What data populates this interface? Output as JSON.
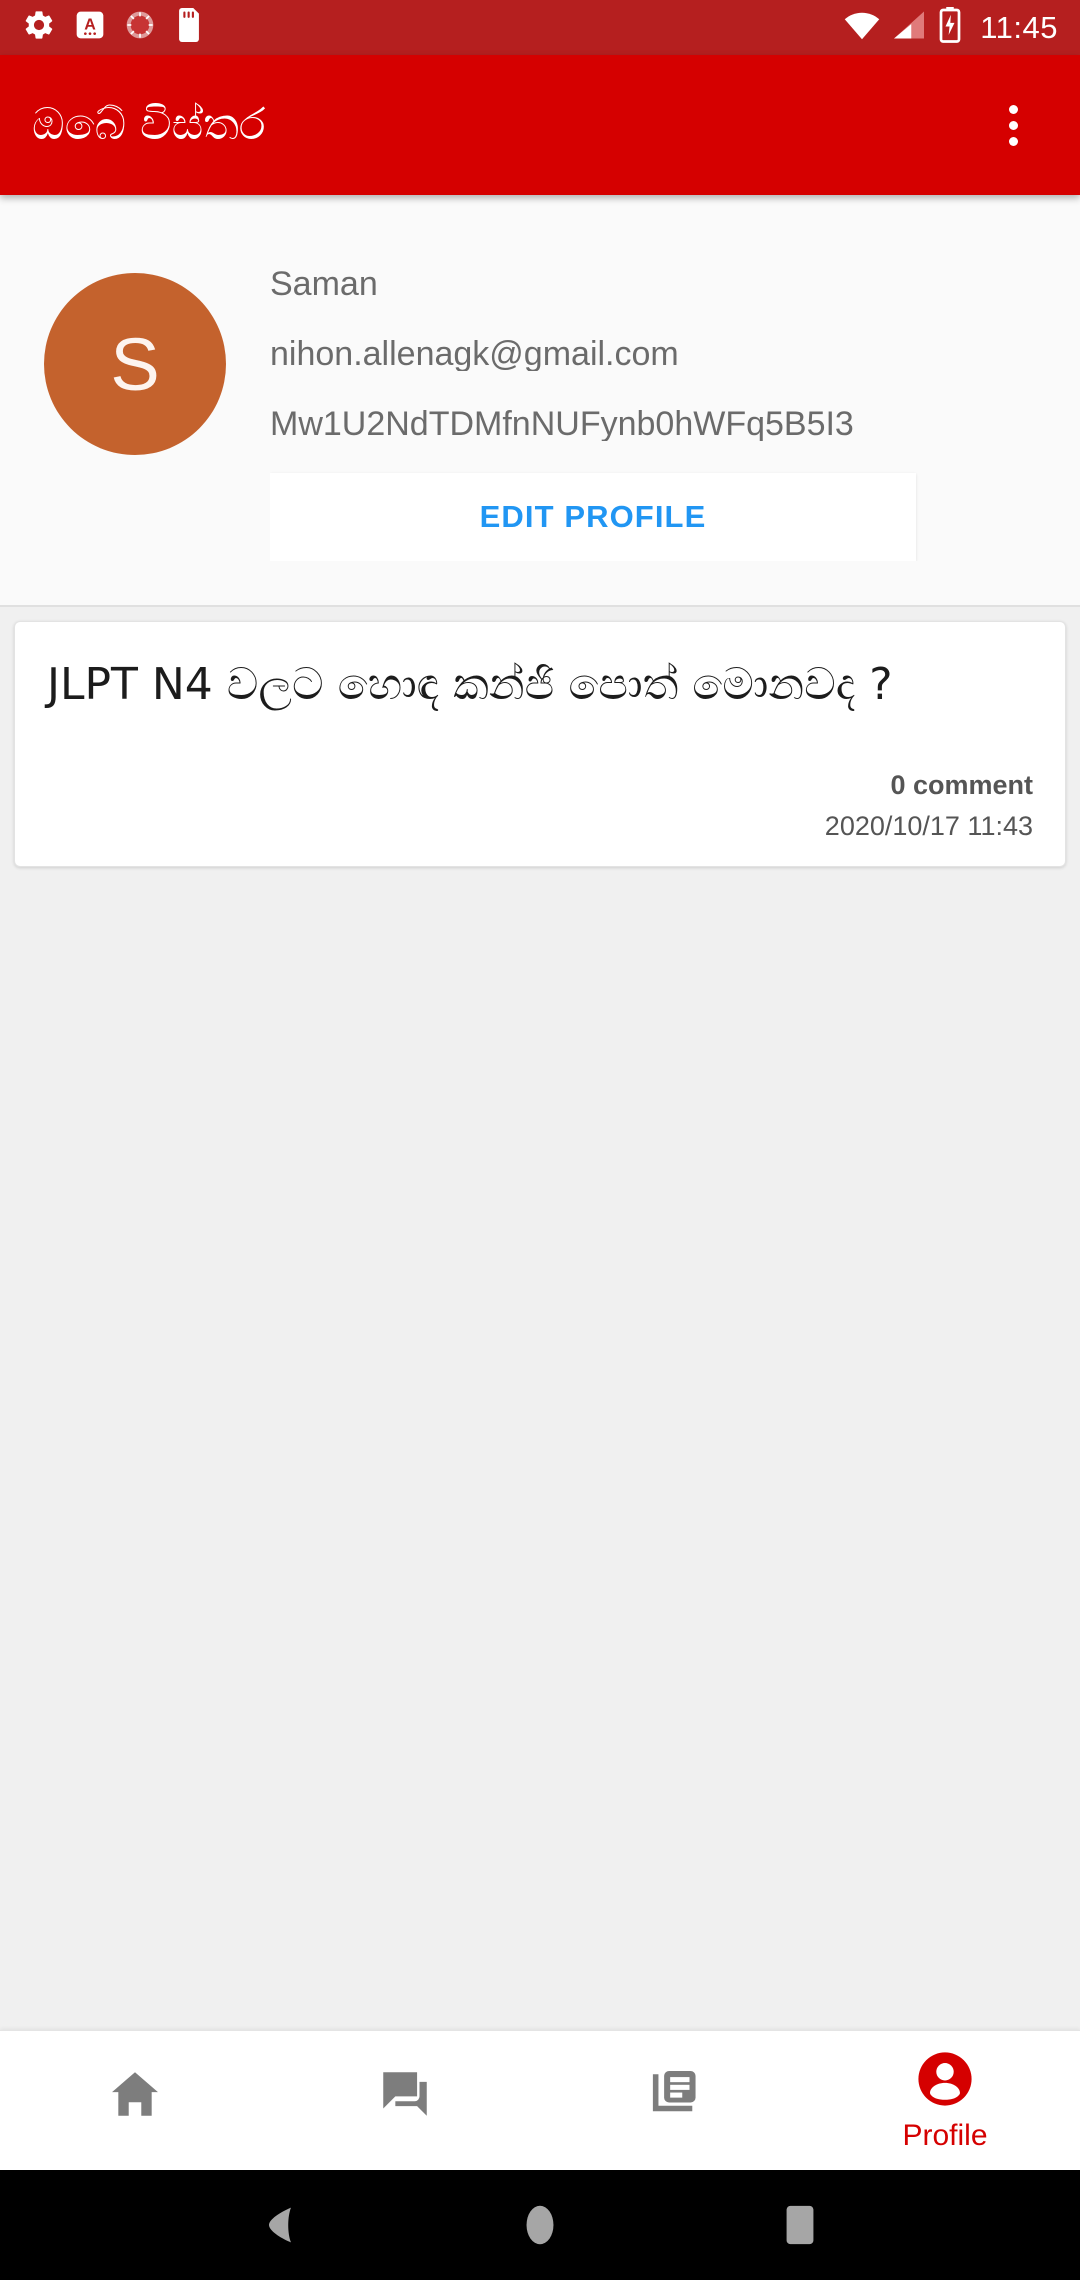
{
  "statusbar": {
    "time": "11:45",
    "icons_left": [
      "settings-gear-icon",
      "keyboard-language-icon",
      "sync-circle-icon",
      "sd-card-icon"
    ],
    "icons_right": [
      "wifi-icon",
      "cellular-signal-icon",
      "battery-charging-icon"
    ]
  },
  "appbar": {
    "title": "ඔබේ විස්තර",
    "overflow_icon": "overflow-menu-icon",
    "background": "#d50000"
  },
  "profile": {
    "avatar_initial": "S",
    "avatar_color": "#c4622d",
    "name": "Saman",
    "email": "nihon.allenagk@gmail.com",
    "user_id": "Mw1U2NdTDMfnNUFynb0hWFq5B5I3",
    "edit_label": "EDIT PROFILE",
    "edit_color": "#2196f3"
  },
  "feed": {
    "posts": [
      {
        "title": "JLPT N4 වලට හොඳ කන්ජි පොත් මොනවද ?",
        "comments": "0 comment",
        "date": "2020/10/17 11:43"
      }
    ]
  },
  "bottomnav": {
    "active_color": "#d50000",
    "inactive_color": "#7d7d7d",
    "items": [
      {
        "icon": "home-icon",
        "label": ""
      },
      {
        "icon": "forum-chat-icon",
        "label": ""
      },
      {
        "icon": "article-reader-icon",
        "label": ""
      },
      {
        "icon": "account-circle-icon",
        "label": "Profile"
      }
    ]
  },
  "androidnav": {
    "buttons": [
      "back-triangle-icon",
      "home-circle-icon",
      "recents-square-icon"
    ]
  }
}
